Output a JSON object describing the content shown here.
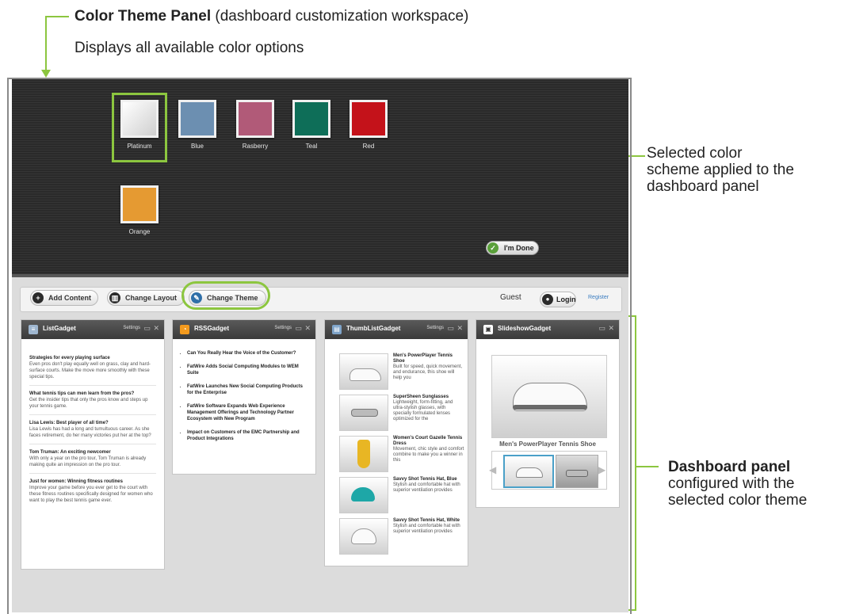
{
  "annotations": {
    "title_bold": "Color Theme Panel",
    "title_rest": " (dashboard customization workspace)",
    "subtitle": "Displays all available color options",
    "selected_line1": "Selected color",
    "selected_line2": "scheme applied to the",
    "selected_line3": "dashboard panel",
    "dashboard_bold": "Dashboard panel",
    "dashboard_line2": "configured with the",
    "dashboard_line3": "selected color theme",
    "accent_color": "#8cc63f"
  },
  "theme_panel": {
    "swatches": [
      {
        "label": "Platinum",
        "color": "#e4e4e4",
        "selected": true
      },
      {
        "label": "Blue",
        "color": "#6c8fb1"
      },
      {
        "label": "Rasberry",
        "color": "#b15a78"
      },
      {
        "label": "Teal",
        "color": "#0e6e58"
      },
      {
        "label": "Red",
        "color": "#c4121a"
      },
      {
        "label": "Orange",
        "color": "#e59a32"
      }
    ],
    "done_label": "I'm Done"
  },
  "toolbar": {
    "add_content": "Add Content",
    "change_layout": "Change Layout",
    "change_theme": "Change Theme",
    "guest": "Guest",
    "login": "Login",
    "register": "Register"
  },
  "gadgets": {
    "list": {
      "title": "ListGadget",
      "settings": "Settings",
      "items": [
        {
          "title": "Strategies for every playing surface",
          "body": "Even pros don't play equally well on grass, clay and hard-surface courts. Make the move more smoothly with these special tips."
        },
        {
          "title": "What tennis tips can men learn from the pros?",
          "body": "Get the insider tips that only the pros know and steps up your tennis game."
        },
        {
          "title": "Lisa Lewis: Best player of all time?",
          "body": "Lisa Lewis has had a long and tumultuous career. As she faces retirement, do her many victories put her at the top?"
        },
        {
          "title": "Tom Truman: An exciting newcomer",
          "body": "With only a year on the pro tour, Tom Truman is already making quite an impression on the pro tour."
        },
        {
          "title": "Just for women: Winning fitness routines",
          "body": "Improve your game before you ever get to the court with these fitness routines specifically designed for women who want to play the best tennis game ever."
        }
      ]
    },
    "rss": {
      "title": "RSSGadget",
      "settings": "Settings",
      "items": [
        "Can You Really Hear the Voice of the Customer?",
        "FatWire Adds Social Computing Modules to WEM Suite",
        "FatWire Launches New Social Computing Products for the Enterprise",
        "FatWire Software Expands Web Experience Management Offerings and Technology Partner Ecosystem with New Program",
        "Impact on Customers of the EMC Partnership and Product Integrations"
      ]
    },
    "thumblist": {
      "title": "ThumbListGadget",
      "settings": "Settings",
      "items": [
        {
          "title": "Men's PowerPlayer Tennis Shoe",
          "body": "Built for speed, quick movement, and endurance, this shoe will help you"
        },
        {
          "title": "SuperSheen Sunglasses",
          "body": "Lightweight, form-fitting, and ultra-stylish glasses, with specially formulated lenses optimized for the"
        },
        {
          "title": "Women's Court Gazelle Tennis Dress",
          "body": "Movement, chic style and comfort combine to make you a winner in this"
        },
        {
          "title": "Savvy Shot Tennis Hat, Blue",
          "body": "Stylish and comfortable hat with superior ventilation provides"
        },
        {
          "title": "Savvy Shot Tennis Hat, White",
          "body": "Stylish and comfortable hat with superior ventilation provides"
        }
      ]
    },
    "slideshow": {
      "title": "SlideshowGadget",
      "caption": "Men's PowerPlayer Tennis Shoe"
    }
  }
}
